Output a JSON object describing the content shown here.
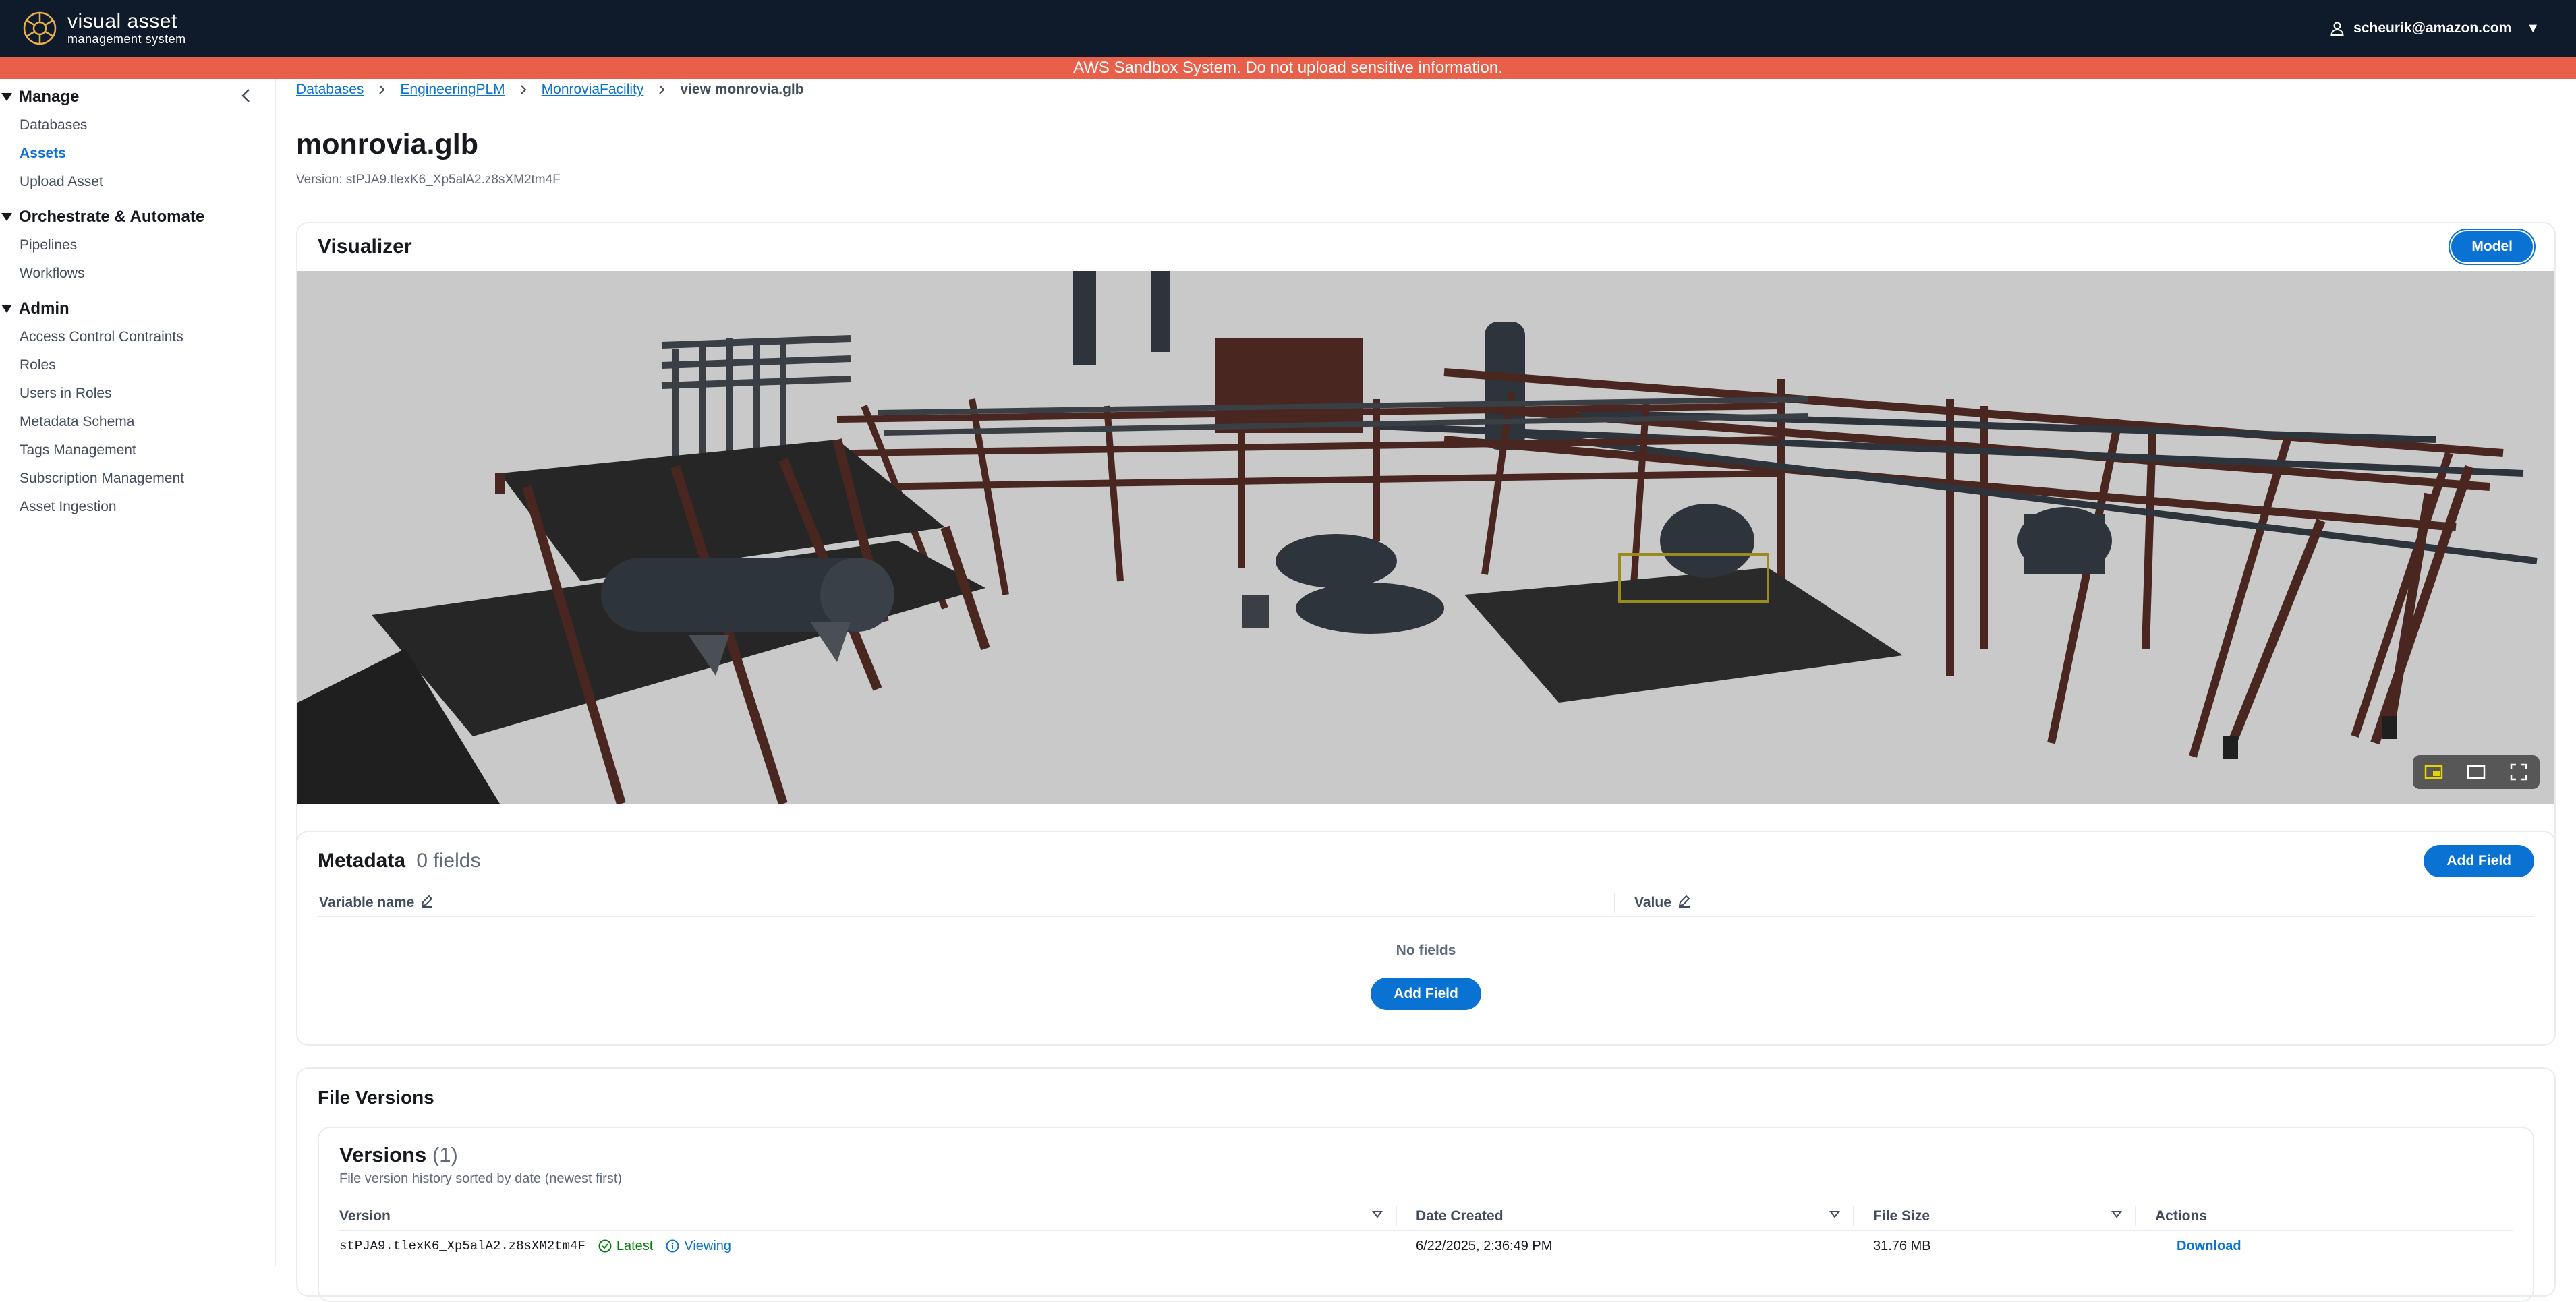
{
  "app": {
    "logo_main": "visual asset",
    "logo_sub": "management system",
    "user_email": "scheurik@amazon.com"
  },
  "banner": {
    "text": "AWS Sandbox System. Do not upload sensitive information."
  },
  "sidebar": {
    "sections": [
      {
        "title": "Manage",
        "items": [
          {
            "label": "Databases",
            "active": false
          },
          {
            "label": "Assets",
            "active": true
          },
          {
            "label": "Upload Asset",
            "active": false
          }
        ]
      },
      {
        "title": "Orchestrate & Automate",
        "items": [
          {
            "label": "Pipelines",
            "active": false
          },
          {
            "label": "Workflows",
            "active": false
          }
        ]
      },
      {
        "title": "Admin",
        "items": [
          {
            "label": "Access Control Contraints",
            "active": false
          },
          {
            "label": "Roles",
            "active": false
          },
          {
            "label": "Users in Roles",
            "active": false
          },
          {
            "label": "Metadata Schema",
            "active": false
          },
          {
            "label": "Tags Management",
            "active": false
          },
          {
            "label": "Subscription Management",
            "active": false
          },
          {
            "label": "Asset Ingestion",
            "active": false
          }
        ]
      }
    ]
  },
  "breadcrumb": {
    "items": [
      "Databases",
      "EngineeringPLM",
      "MonroviaFacility"
    ],
    "current": "view monrovia.glb"
  },
  "page": {
    "title": "monrovia.glb",
    "version_line": "Version: stPJA9.tlexK6_Xp5alA2.z8sXM2tm4F"
  },
  "visualizer": {
    "title": "Visualizer",
    "mode_button": "Model",
    "background_color": "#c9c9c9"
  },
  "metadata": {
    "title": "Metadata",
    "count_label": "0 fields",
    "add_button": "Add Field",
    "col_variable": "Variable name",
    "col_value": "Value",
    "empty_text": "No fields",
    "empty_add_button": "Add Field"
  },
  "file_versions": {
    "title": "File Versions",
    "versions_title": "Versions",
    "versions_count": "(1)",
    "description": "File version history sorted by date (newest first)",
    "columns": {
      "version": "Version",
      "date": "Date Created",
      "size": "File Size",
      "actions": "Actions"
    },
    "rows": [
      {
        "version": "stPJA9.tlexK6_Xp5alA2.z8sXM2tm4F",
        "latest_label": "Latest",
        "viewing_label": "Viewing",
        "date": "6/22/2025, 2:36:49 PM",
        "size": "31.76 MB",
        "action": "Download"
      }
    ]
  },
  "colors": {
    "topbar": "#0f1b2a",
    "banner": "#e8604a",
    "accent": "#0972d3",
    "latest_green": "#037f0c",
    "steel_rust": "#4a2620",
    "equipment_dark": "#2e343b"
  }
}
